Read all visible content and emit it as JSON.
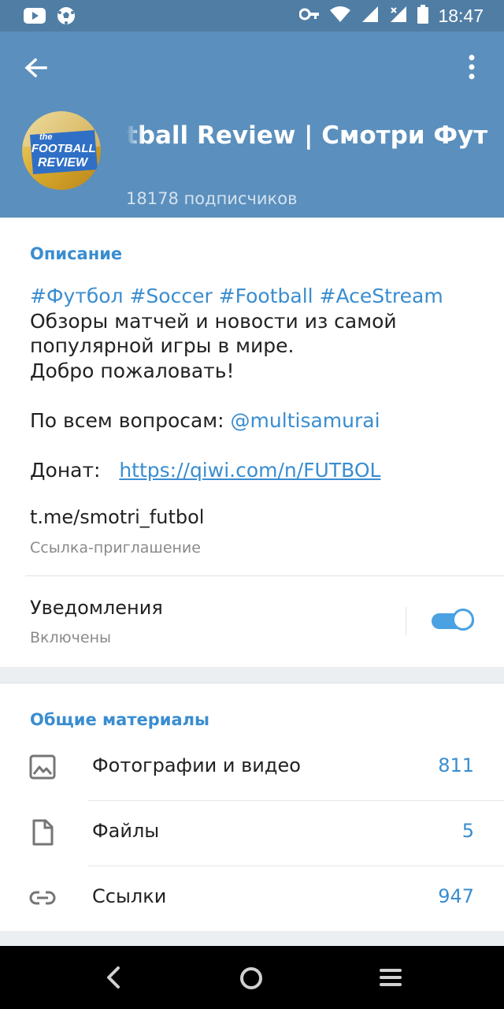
{
  "status_bar": {
    "time": "18:47",
    "left_icons": [
      "youtube-icon",
      "soccer-ball-icon"
    ],
    "right_icons": [
      "key-icon",
      "wifi-icon",
      "signal-icon",
      "battery-icon"
    ]
  },
  "header": {
    "title": "tball Review | Смотри Футбол.",
    "subscribers": "18178 подписчиков",
    "avatar_text_line1": "the",
    "avatar_text_line2": "FOOTBALL",
    "avatar_text_line3": "REVIEW",
    "background_color": "#5b8fbd"
  },
  "info": {
    "section_title": "Описание",
    "hashtags": "#Футбол #Soccer #Football #AceStream",
    "line1": "Обзоры матчей и новости из самой",
    "line2": "популярной игры в мире.",
    "line3": "Добро пожаловать!",
    "questions_prefix": "По всем вопросам: ",
    "questions_handle": "@multisamurai",
    "donate_prefix": "Донат:",
    "donate_url": "https://qiwi.com/n/FUTBOL",
    "invite_link": "t.me/smotri_futbol",
    "invite_caption": "Ссылка-приглашение",
    "notifications_label": "Уведомления",
    "notifications_status": "Включены",
    "notifications_enabled": true
  },
  "media": {
    "section_title": "Общие материалы",
    "rows": [
      {
        "label": "Фотографии и видео",
        "count": "811",
        "icon": "photo-icon"
      },
      {
        "label": "Файлы",
        "count": "5",
        "icon": "file-icon"
      },
      {
        "label": "Ссылки",
        "count": "947",
        "icon": "link-icon"
      }
    ]
  },
  "colors": {
    "accent": "#3a8dd0",
    "status_bar": "#507da4",
    "toggle": "#4aa2e2"
  }
}
